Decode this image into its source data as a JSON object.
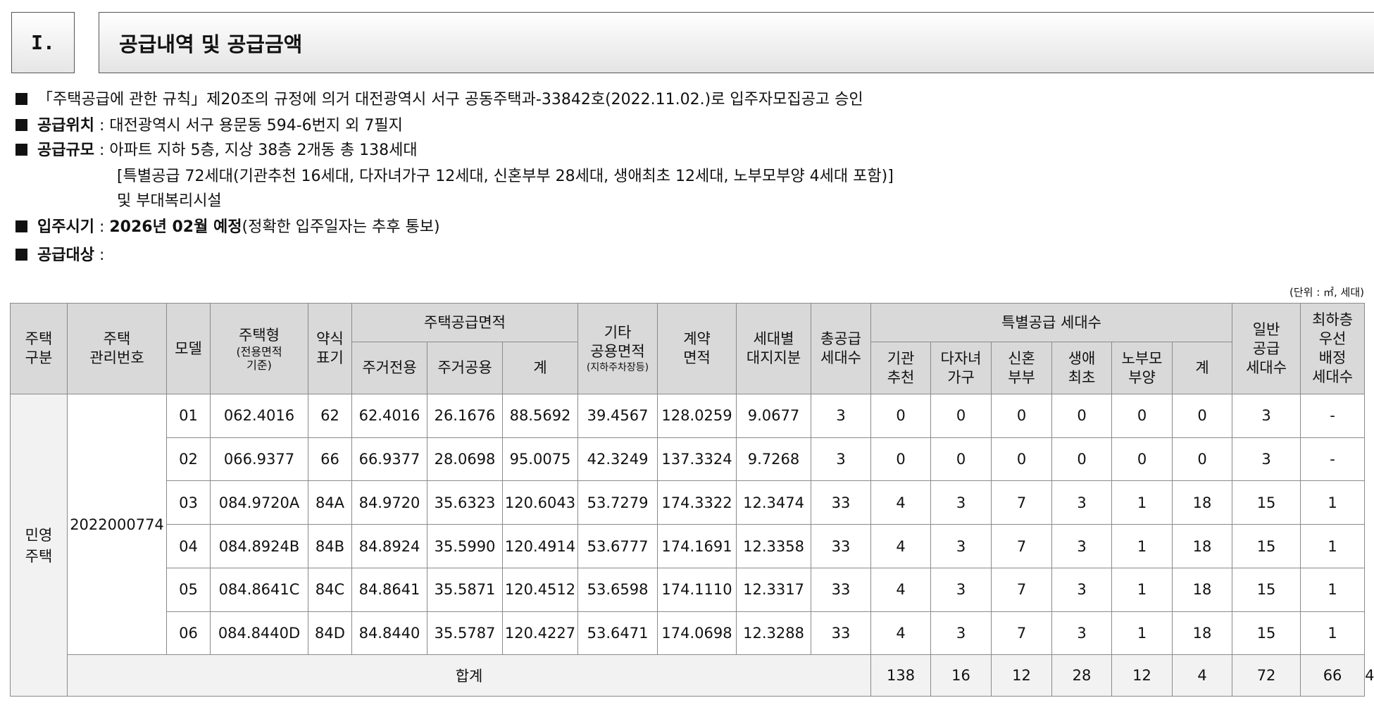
{
  "section": {
    "number": "I.",
    "title": "공급내역 및 공급금액"
  },
  "intro": {
    "approval": "「주택공급에 관한 규칙」제20조의 규정에 의거 대전광역시 서구 공동주택과-33842호(2022.11.02.)로 입주자모집공고 승인",
    "location_label": "공급위치",
    "location_value": " : 대전광역시 서구 용문동 594-6번지 외 7필지",
    "scale_label": "공급규모",
    "scale_value": " : 아파트 지하 5층, 지상 38층 2개동 총 138세대",
    "scale_line2": "[특별공급 72세대(기관추천 16세대, 다자녀가구 12세대, 신혼부부 28세대, 생애최초 12세대, 노부모부양 4세대 포함)]",
    "scale_line3": "및 부대복리시설",
    "movein_label": "입주시기",
    "movein_sep": " : ",
    "movein_bold": "2026년 02월 예정",
    "movein_note": "(정확한 입주일자는 추후 통보)",
    "target_label": "공급대상",
    "target_sep": " :"
  },
  "unit_note": "(단위 : ㎡, 세대)",
  "table": {
    "headers": {
      "housing_type": [
        "주택",
        "구분"
      ],
      "management_no": [
        "주택",
        "관리번호"
      ],
      "model": "모델",
      "unit_type": [
        "주택형",
        "(전용면적",
        "기준)"
      ],
      "abbr": [
        "약식",
        "표기"
      ],
      "supply_area": "주택공급면적",
      "exclusive": "주거전용",
      "common": "주거공용",
      "area_sum": "계",
      "other_common": [
        "기타",
        "공용면적",
        "(지하주차장등)"
      ],
      "contract_area": [
        "계약",
        "면적"
      ],
      "land_share": [
        "세대별",
        "대지지분"
      ],
      "total_units": [
        "총공급",
        "세대수"
      ],
      "special": "특별공급 세대수",
      "institution": [
        "기관",
        "추천"
      ],
      "multichild": [
        "다자녀",
        "가구"
      ],
      "newlywed": [
        "신혼",
        "부부"
      ],
      "firsttime": [
        "생애",
        "최초"
      ],
      "elderly": [
        "노부모",
        "부양"
      ],
      "special_sum": "계",
      "general": [
        "일반",
        "공급",
        "세대수"
      ],
      "lowest_floor": [
        "최하층",
        "우선",
        "배정",
        "세대수"
      ]
    },
    "housing_type_value": [
      "민영",
      "주택"
    ],
    "management_no_value": "2022000774",
    "rows": [
      [
        "01",
        "062.4016",
        "62",
        "62.4016",
        "26.1676",
        "88.5692",
        "39.4567",
        "128.0259",
        "9.0677",
        "3",
        "0",
        "0",
        "0",
        "0",
        "0",
        "0",
        "3",
        "-"
      ],
      [
        "02",
        "066.9377",
        "66",
        "66.9377",
        "28.0698",
        "95.0075",
        "42.3249",
        "137.3324",
        "9.7268",
        "3",
        "0",
        "0",
        "0",
        "0",
        "0",
        "0",
        "3",
        "-"
      ],
      [
        "03",
        "084.9720A",
        "84A",
        "84.9720",
        "35.6323",
        "120.6043",
        "53.7279",
        "174.3322",
        "12.3474",
        "33",
        "4",
        "3",
        "7",
        "3",
        "1",
        "18",
        "15",
        "1"
      ],
      [
        "04",
        "084.8924B",
        "84B",
        "84.8924",
        "35.5990",
        "120.4914",
        "53.6777",
        "174.1691",
        "12.3358",
        "33",
        "4",
        "3",
        "7",
        "3",
        "1",
        "18",
        "15",
        "1"
      ],
      [
        "05",
        "084.8641C",
        "84C",
        "84.8641",
        "35.5871",
        "120.4512",
        "53.6598",
        "174.1110",
        "12.3317",
        "33",
        "4",
        "3",
        "7",
        "3",
        "1",
        "18",
        "15",
        "1"
      ],
      [
        "06",
        "084.8440D",
        "84D",
        "84.8440",
        "35.5787",
        "120.4227",
        "53.6471",
        "174.0698",
        "12.3288",
        "33",
        "4",
        "3",
        "7",
        "3",
        "1",
        "18",
        "15",
        "1"
      ]
    ],
    "total_label": "합계",
    "total_values": [
      "138",
      "16",
      "12",
      "28",
      "12",
      "4",
      "72",
      "66",
      "4"
    ]
  }
}
